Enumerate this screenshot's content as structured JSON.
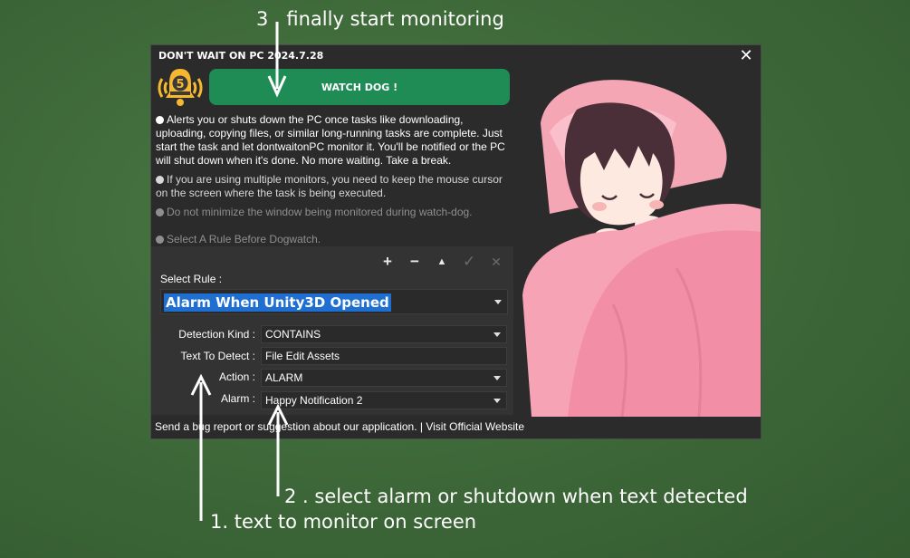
{
  "annotations": {
    "step3": "3 . finally start monitoring",
    "step2": "2 . select alarm or shutdown when text detected",
    "step1": "1. text to monitor on screen"
  },
  "window": {
    "title": "DON'T WAIT ON PC 2024.7.28",
    "close_glyph": "✕",
    "bell_badge": "5",
    "watchdog_label": "WATCH DOG !"
  },
  "info": [
    "Alerts you or shuts down the PC once tasks like downloading, uploading, copying files, or similar long-running tasks are complete. Just start the task and let dontwaitonPC monitor it. You'll be notified or the PC will shut down when it's done. No more waiting. Take a break.",
    "If you are using multiple monitors, you need to keep the mouse cursor on the screen where the task is being executed.",
    "Do not minimize the window being monitored during watch-dog.",
    "Select A Rule Before Dogwatch."
  ],
  "rule_tools": {
    "add": "+",
    "remove": "−",
    "move_up": "▲",
    "confirm": "✓",
    "delete": "✕"
  },
  "rule": {
    "select_label": "Select Rule :",
    "selected": "Alarm When Unity3D Opened",
    "detection_kind_label": "Detection Kind :",
    "detection_kind_value": "CONTAINS",
    "text_to_detect_label": "Text To Detect :",
    "text_to_detect_value": "File Edit Assets",
    "action_label": "Action :",
    "action_value": "ALARM",
    "alarm_label": "Alarm :",
    "alarm_value": "Happy Notification 2"
  },
  "footer": {
    "bug_report": "Send a bug report or suggestion about our application.",
    "separator": " | ",
    "website": "Visit Official Website"
  },
  "colors": {
    "chalkboard": "#3f6a3a",
    "window_bg": "#2b2b2b",
    "panel_bg": "#333333",
    "watchdog_green": "#1f8c56",
    "bell_yellow": "#f5b82e",
    "selection_blue": "#1e6fd1",
    "illustration_pink": "#f7a3b6"
  }
}
